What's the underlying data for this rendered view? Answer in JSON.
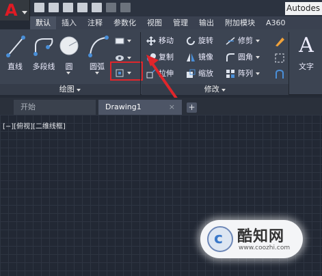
{
  "app": {
    "title": "Autodes"
  },
  "quick_access": [
    "new-icon",
    "open-icon",
    "save-icon",
    "saveas-icon",
    "print-icon",
    "undo-icon",
    "redo-icon"
  ],
  "tabs": [
    "默认",
    "插入",
    "注释",
    "参数化",
    "视图",
    "管理",
    "输出",
    "附加模块",
    "A360"
  ],
  "ribbon": {
    "draw": {
      "title": "绘图",
      "tools": [
        "直线",
        "多段线",
        "圆",
        "圆弧"
      ]
    },
    "modify": {
      "title": "修改",
      "tools": [
        "移动",
        "旋转",
        "修剪",
        "复制",
        "镜像",
        "圆角",
        "拉伸",
        "缩放",
        "阵列"
      ]
    },
    "annotation": {
      "text": "文字"
    }
  },
  "document_tabs": {
    "start": "开始",
    "current": "Drawing1",
    "close": "×",
    "add": "+"
  },
  "viewport_label": "[−][俯视][二维线框]",
  "watermark": {
    "brand": "酷知网",
    "url": "www.coozhi.com"
  },
  "colors": {
    "highlight": "#e0262b",
    "logo_red": "#e01b24"
  }
}
